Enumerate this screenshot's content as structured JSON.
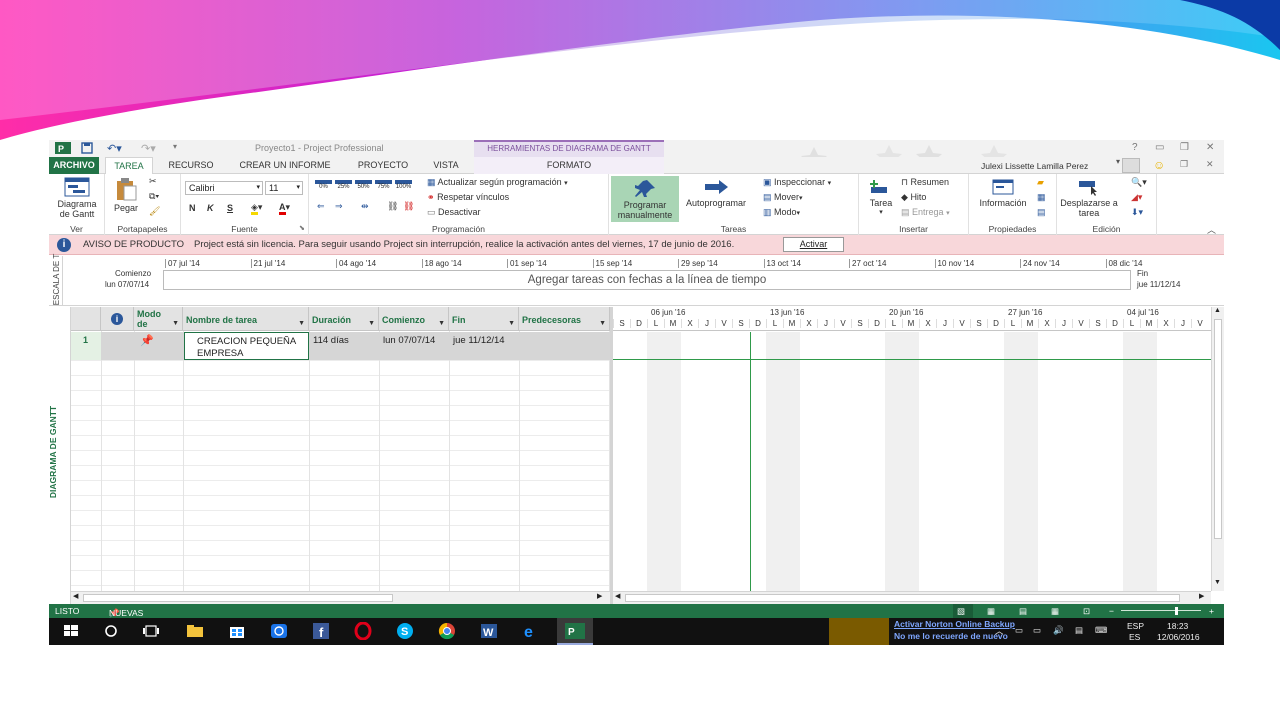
{
  "app": {
    "window_title": "Proyecto1 - Project Professional",
    "context_title": "HERRAMIENTAS DE DIAGRAMA DE GANTT",
    "user": "Julexi Lissette Lamilla Perez",
    "help": "?"
  },
  "tabs": [
    {
      "label": "ARCHIVO"
    },
    {
      "label": "TAREA"
    },
    {
      "label": "RECURSO"
    },
    {
      "label": "CREAR UN INFORME"
    },
    {
      "label": "PROYECTO"
    },
    {
      "label": "VISTA"
    },
    {
      "label": "FORMATO"
    }
  ],
  "ribbon": {
    "ver": {
      "button": "Diagrama de Gantt",
      "label": "Ver"
    },
    "portapapeles": {
      "button": "Pegar",
      "label": "Portapapeles"
    },
    "fuente": {
      "font": "Calibri",
      "size": "11",
      "bold": "N",
      "italic": "K",
      "underline": "S",
      "label": "Fuente"
    },
    "programacion": {
      "pct": [
        "0%",
        "25%",
        "50%",
        "75%",
        "100%"
      ],
      "actualizar": "Actualizar según programación",
      "respetar": "Respetar vínculos",
      "desactivar": "Desactivar",
      "label": "Programación"
    },
    "tareas": {
      "programar": "Programar manualmente",
      "autoprogramar": "Autoprogramar",
      "inspeccionar": "Inspeccionar",
      "mover": "Mover",
      "modo": "Modo",
      "label": "Tareas"
    },
    "insertar": {
      "tarea": "Tarea",
      "resumen": "Resumen",
      "hito": "Hito",
      "entrega": "Entrega",
      "label": "Insertar"
    },
    "propiedades": {
      "informacion": "Información",
      "label": "Propiedades"
    },
    "edicion": {
      "desplazarse": "Desplazarse a tarea",
      "label": "Edición"
    }
  },
  "notice": {
    "title": "AVISO DE PRODUCTO",
    "message": "Project está sin licencia. Para seguir usando Project sin interrupción, realice la activación antes del viernes, 17 de junio de 2016.",
    "button": "Activar"
  },
  "timeline": {
    "side_label": "ESCALA DE T",
    "start_label": "Comienzo",
    "start_date": "lun 07/07/14",
    "end_label": "Fin",
    "end_date": "jue 11/12/14",
    "placeholder": "Agregar tareas con fechas a la línea de tiempo",
    "dates": [
      "07 jul '14",
      "21 jul '14",
      "04 ago '14",
      "18 ago '14",
      "01 sep '14",
      "15 sep '14",
      "29 sep '14",
      "13 oct '14",
      "27 oct '14",
      "10 nov '14",
      "24 nov '14",
      "08 dic '14"
    ]
  },
  "grid": {
    "side_label": "DIAGRAMA DE GANTT",
    "headers": {
      "info": "i",
      "modo": "Modo de",
      "nombre": "Nombre de tarea",
      "duracion": "Duración",
      "comienzo": "Comienzo",
      "fin": "Fin",
      "predecesoras": "Predecesoras"
    },
    "rows": [
      {
        "id": "1",
        "nombre": "CREACION PEQUEÑA EMPRESA",
        "duracion": "114 días",
        "comienzo": "lun 07/07/14",
        "fin": "jue 11/12/14",
        "predecesoras": ""
      }
    ]
  },
  "gantt": {
    "weeks": [
      "06 jun '16",
      "13 jun '16",
      "20 jun '16",
      "27 jun '16",
      "04 jul '16"
    ],
    "days": [
      "S",
      "D",
      "L",
      "M",
      "X",
      "J",
      "V",
      "S",
      "D",
      "L",
      "M",
      "X",
      "J",
      "V",
      "S",
      "D",
      "L",
      "M",
      "X",
      "J",
      "V",
      "S",
      "D",
      "L",
      "M",
      "X",
      "J",
      "V",
      "S",
      "D",
      "L",
      "M",
      "X",
      "J",
      "V"
    ]
  },
  "status": {
    "ready": "LISTO",
    "new_tasks": "NUEVAS TAREAS : PROGRAMADA MANUALMENTE"
  },
  "taskbar": {
    "lang": "ESP",
    "lang2": "ES",
    "time": "18:23",
    "date": "12/06/2016",
    "notif1": "Activar Norton Online Backup",
    "notif2": "No me lo recuerde de nuevo"
  },
  "colors": {
    "accent": "#217346",
    "notice_bg": "#f8d7da",
    "context": "#9b6fb8"
  }
}
